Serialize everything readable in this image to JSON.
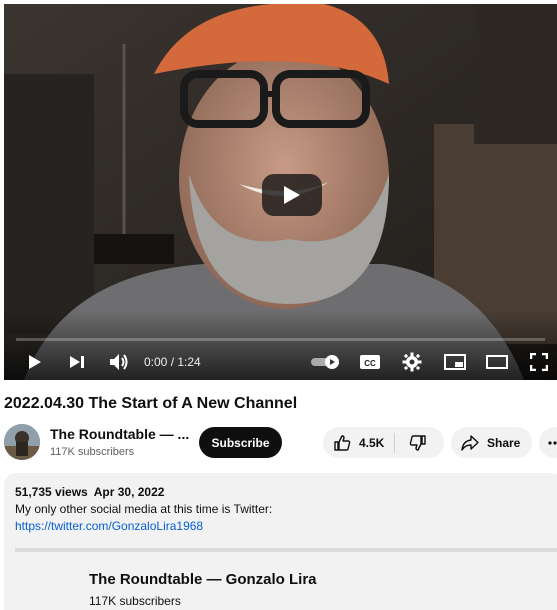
{
  "player": {
    "time_current": "0:00",
    "time_separator": " / ",
    "time_total": "1:24",
    "progress": 0
  },
  "video": {
    "title": "2022.04.30 The Start of A New Channel"
  },
  "channel": {
    "name": "The Roundtable — ...",
    "subscribers": "117K subscribers",
    "subscribe_label": "Subscribe"
  },
  "actions": {
    "like_count": "4.5K",
    "share_label": "Share"
  },
  "description": {
    "views": "51,735 views",
    "date": "Apr 30, 2022",
    "text": "My only other social media at this time is Twitter:",
    "link": "https://twitter.com/GonzaloLira1968",
    "channel_name": "The Roundtable — Gonzalo Lira",
    "channel_subscribers": "117K subscribers"
  },
  "colors": {
    "subscribe_bg": "#0f0f0f",
    "pill_bg": "#f2f2f2",
    "link": "#065fd4",
    "description_bg": "#f2f2f2"
  },
  "icons": [
    "play-icon",
    "next-icon",
    "volume-icon",
    "autoplay-toggle-icon",
    "captions-icon",
    "settings-gear-icon",
    "miniplayer-icon",
    "theater-mode-icon",
    "fullscreen-icon",
    "thumbs-up-icon",
    "thumbs-down-icon",
    "share-arrow-icon",
    "more-icon"
  ]
}
